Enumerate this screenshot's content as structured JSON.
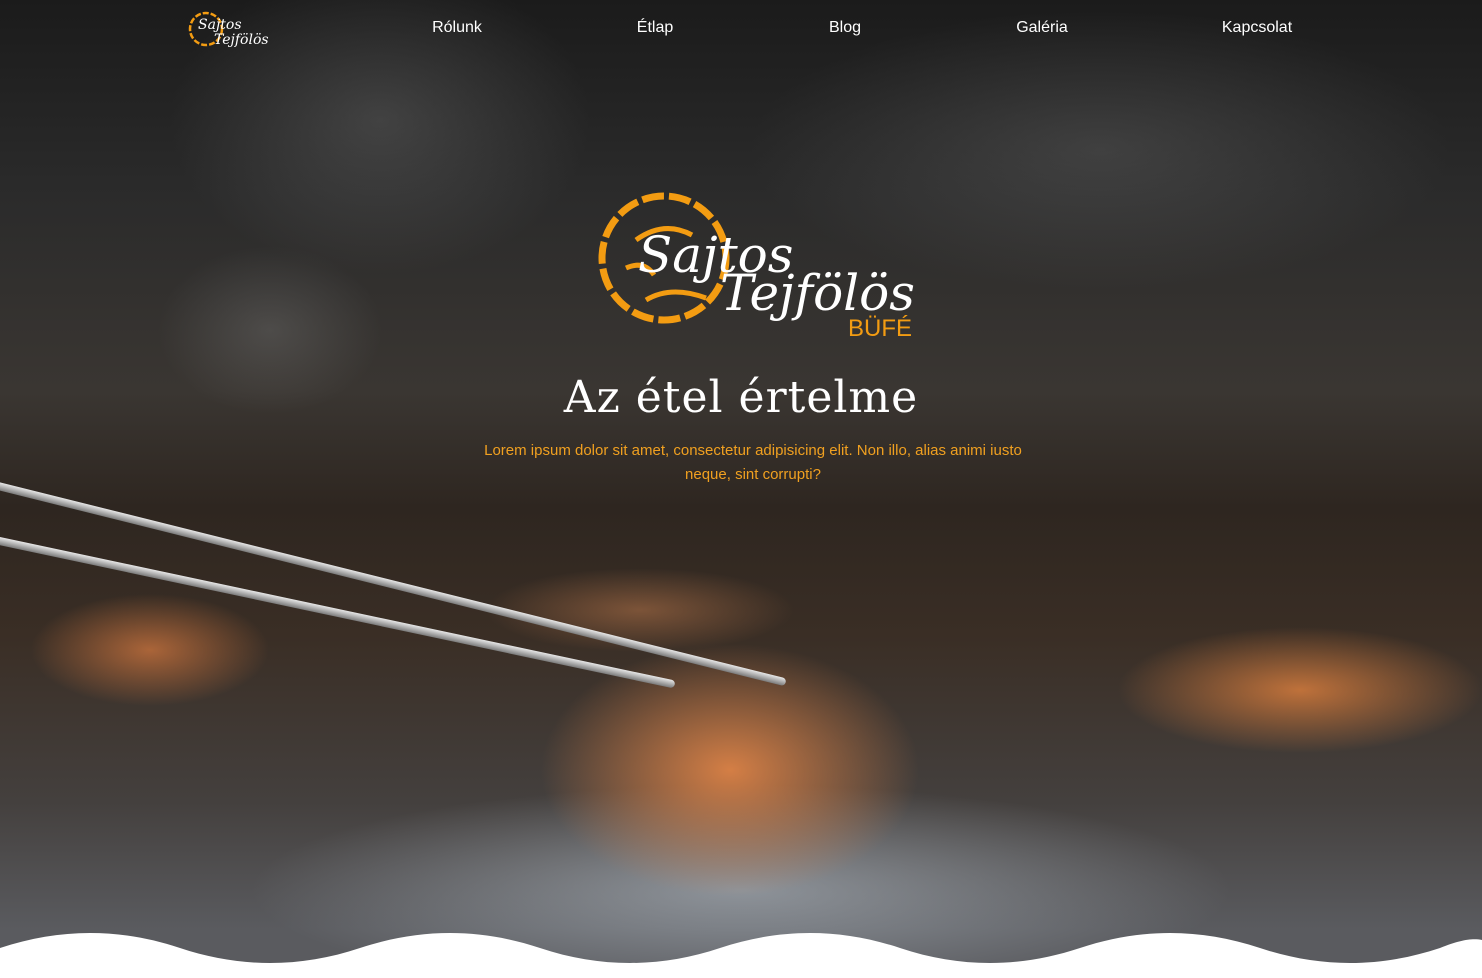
{
  "brand": {
    "name_line1": "Sajtos",
    "name_line2": "Tejfölös",
    "subtitle": "BÜFÉ",
    "accent_color": "#f39c12"
  },
  "nav": {
    "items": [
      {
        "label": "Rólunk"
      },
      {
        "label": "Étlap"
      },
      {
        "label": "Blog"
      },
      {
        "label": "Galéria"
      },
      {
        "label": "Kapcsolat"
      }
    ]
  },
  "hero": {
    "title": "Az étel értelme",
    "subtitle": "Lorem ipsum dolor sit amet, consectetur adipisicing elit. Non illo, alias animi iusto neque, sint corrupti?",
    "subtitle_color": "#f0a020"
  }
}
